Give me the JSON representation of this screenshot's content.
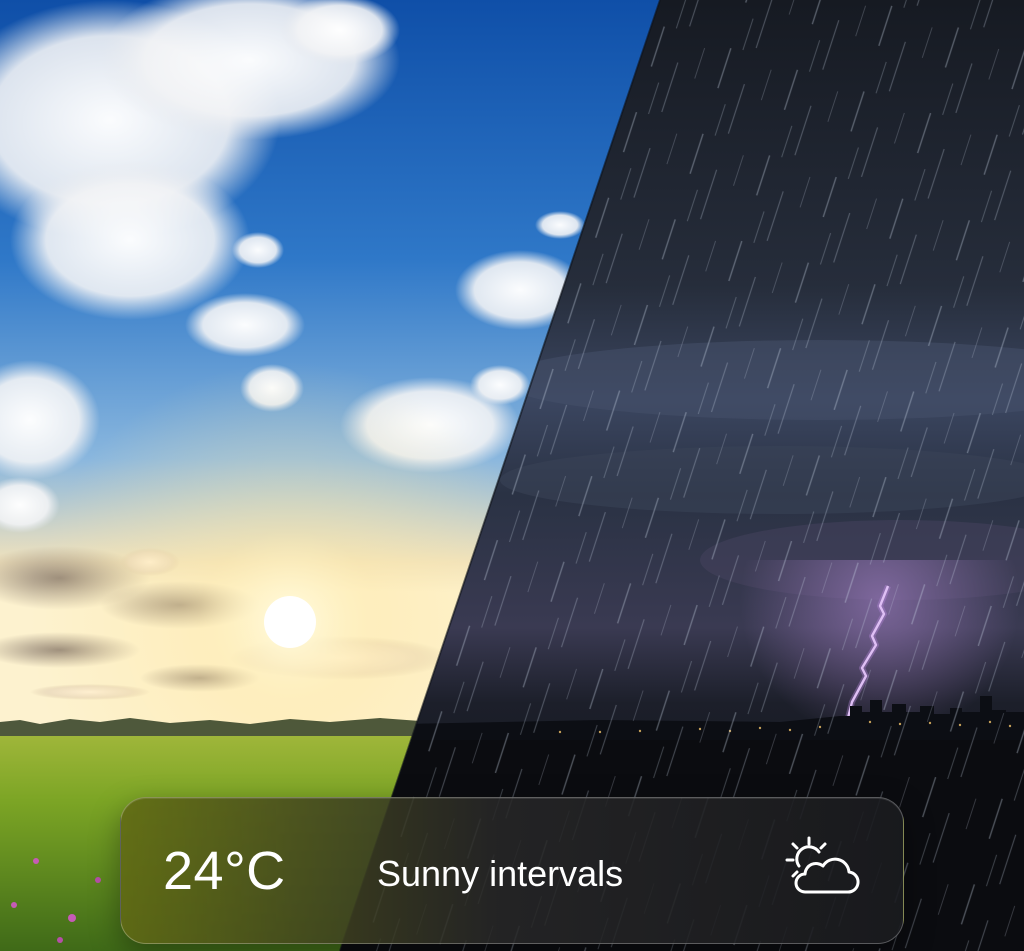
{
  "weather_card": {
    "temperature": "24°C",
    "condition": "Sunny intervals",
    "condition_icon": "partly-cloudy-sun-icon"
  },
  "scene": {
    "left": "sunny sky over green field",
    "right": "night thunderstorm with rain over city skyline"
  },
  "colors": {
    "sky_blue": "#1f63b4",
    "storm_dark": "#1a1f2b",
    "grass_green": "#6f9a1e",
    "lightning": "#e7c9ff"
  }
}
